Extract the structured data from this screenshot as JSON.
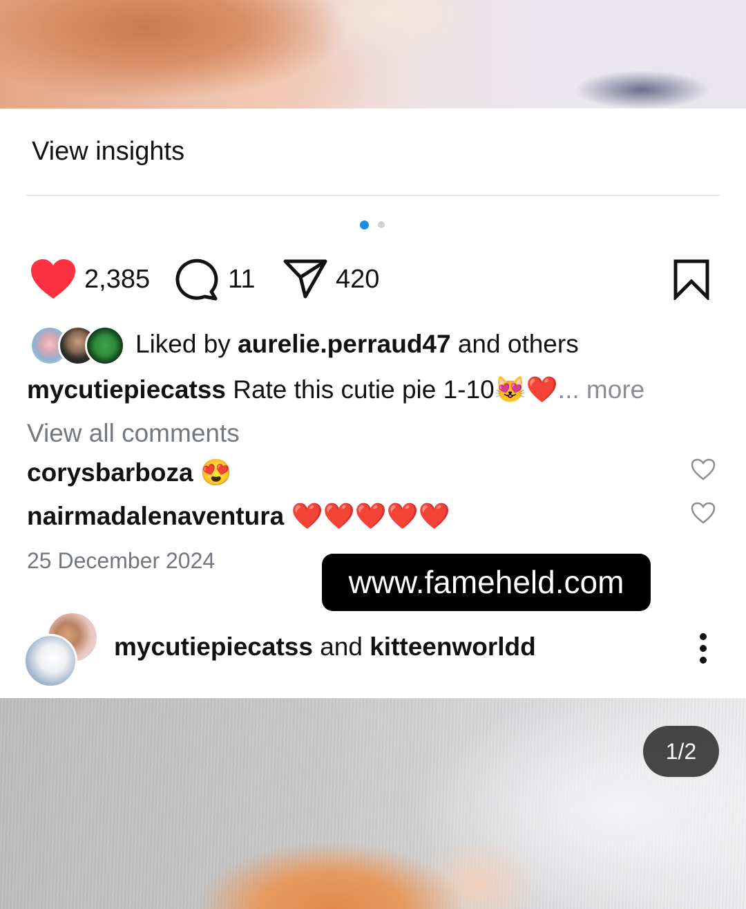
{
  "insights": {
    "label": "View insights"
  },
  "carousel": {
    "active_index": 0,
    "count": 2
  },
  "actions": {
    "like_count": "2,385",
    "comment_count": "11",
    "share_count": "420"
  },
  "likes": {
    "prefix": "Liked by",
    "user": "aurelie.perraud47",
    "suffix": "and others"
  },
  "caption": {
    "username": "mycutiepiecatss",
    "text": "Rate this cutie pie 1-10😻❤️",
    "more": "... more"
  },
  "comments": {
    "view_all": "View all comments",
    "items": [
      {
        "username": "corysbarboza",
        "text": "😍"
      },
      {
        "username": "nairmadalenaventura",
        "text": "❤️❤️❤️❤️❤️"
      }
    ]
  },
  "post_date": "25 December 2024",
  "watermark": "www.fameheld.com",
  "next_post": {
    "author1": "mycutiepiecatss",
    "joiner": "and",
    "author2": "kitteenworldd",
    "counter": "1/2"
  },
  "colors": {
    "like_red": "#ff3040",
    "carousel_active": "#1a8cf0",
    "secondary_text": "#73777e"
  }
}
